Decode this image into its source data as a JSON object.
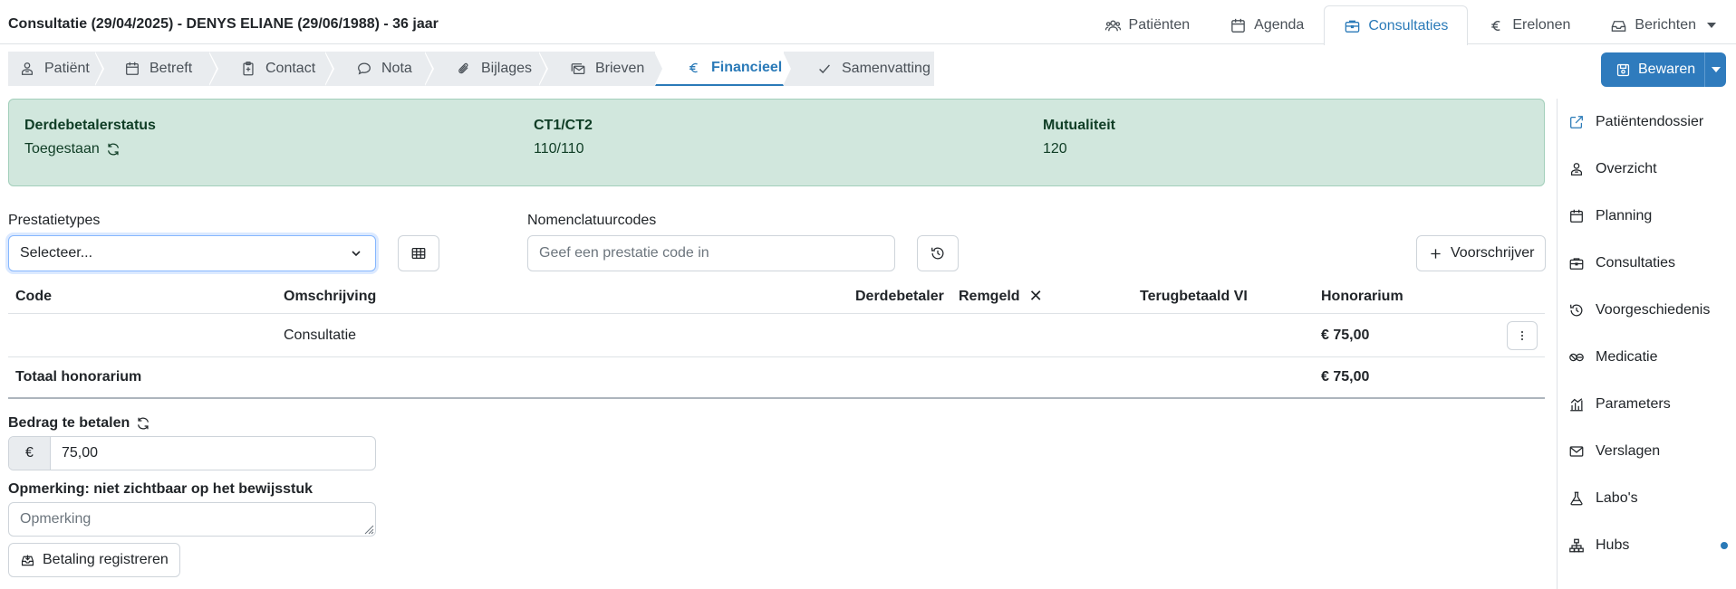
{
  "header": {
    "title": "Consultatie (29/04/2025) - DENYS ELIANE (29/06/1988) - 36 jaar",
    "nav": [
      {
        "label": "Patiënten",
        "icon": "users-icon"
      },
      {
        "label": "Agenda",
        "icon": "calendar-icon"
      },
      {
        "label": "Consultaties",
        "icon": "briefcase-icon",
        "active": true
      },
      {
        "label": "Erelonen",
        "icon": "euro-icon"
      },
      {
        "label": "Berichten",
        "icon": "inbox-icon"
      }
    ]
  },
  "steps": [
    {
      "label": "Patiënt",
      "icon": "person-icon"
    },
    {
      "label": "Betreft",
      "icon": "calendar-icon"
    },
    {
      "label": "Contact",
      "icon": "clipboard-icon"
    },
    {
      "label": "Nota",
      "icon": "chat-icon"
    },
    {
      "label": "Bijlages",
      "icon": "paperclip-icon"
    },
    {
      "label": "Brieven",
      "icon": "mail-stack-icon"
    },
    {
      "label": "Financieel",
      "icon": "euro-icon",
      "active": true
    },
    {
      "label": "Samenvatting",
      "icon": "check-icon"
    }
  ],
  "save_button": {
    "label": "Bewaren"
  },
  "status": {
    "derdebetaler_label": "Derdebetalerstatus",
    "derdebetaler_value": "Toegestaan",
    "ct_label": "CT1/CT2",
    "ct_value": "110/110",
    "mutualiteit_label": "Mutualiteit",
    "mutualiteit_value": "120"
  },
  "form": {
    "prestatietypes_label": "Prestatietypes",
    "prestatietypes_value": "Selecteer...",
    "nomenclatuur_label": "Nomenclatuurcodes",
    "nomenclatuur_placeholder": "Geef een prestatie code in",
    "voorschrijver_label": "Voorschrijver"
  },
  "table": {
    "headers": {
      "code": "Code",
      "omschrijving": "Omschrijving",
      "derdebetaler": "Derdebetaler",
      "remgeld": "Remgeld",
      "terugbetaald": "Terugbetaald VI",
      "honorarium": "Honorarium"
    },
    "rows": [
      {
        "code": "",
        "omschrijving": "Consultatie",
        "derdebetaler": "",
        "remgeld": "",
        "terugbetaald": "",
        "honorarium": "€ 75,00"
      }
    ],
    "total_label": "Totaal honorarium",
    "total_value": "€ 75,00"
  },
  "payment": {
    "amount_label": "Bedrag te betalen",
    "currency": "€",
    "amount_value": "75,00",
    "remark_label": "Opmerking: niet zichtbaar op het bewijsstuk",
    "remark_placeholder": "Opmerking",
    "register_label": "Betaling registreren"
  },
  "sidebar": {
    "items": [
      {
        "label": "Patiëntendossier",
        "icon": "external-link-icon"
      },
      {
        "label": "Overzicht",
        "icon": "person-icon"
      },
      {
        "label": "Planning",
        "icon": "calendar-icon"
      },
      {
        "label": "Consultaties",
        "icon": "briefcase-icon"
      },
      {
        "label": "Voorgeschiedenis",
        "icon": "history-icon"
      },
      {
        "label": "Medicatie",
        "icon": "pills-icon"
      },
      {
        "label": "Parameters",
        "icon": "chart-icon"
      },
      {
        "label": "Verslagen",
        "icon": "envelope-icon"
      },
      {
        "label": "Labo's",
        "icon": "flask-icon"
      },
      {
        "label": "Hubs",
        "icon": "hierarchy-icon"
      }
    ]
  },
  "colors": {
    "accent": "#2a7ab8",
    "save_button": "#2f7bbd",
    "status_bg": "#d1e7dd"
  }
}
